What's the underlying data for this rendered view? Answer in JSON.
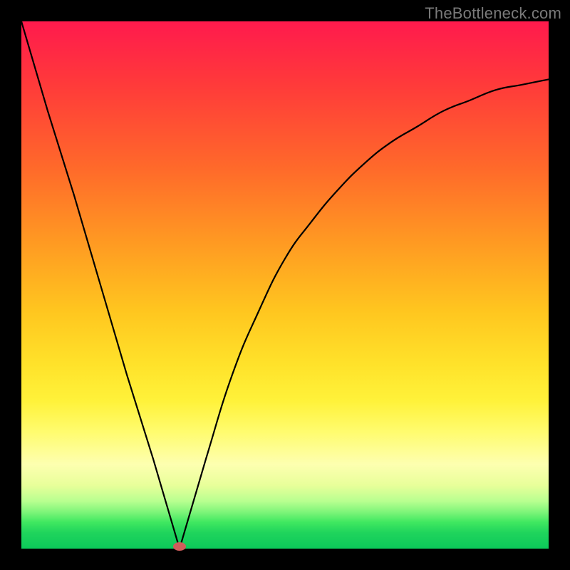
{
  "attribution": "TheBottleneck.com",
  "marker_color": "#cf5d5b",
  "curve_color": "#000000",
  "curve_stroke_width": 2.2,
  "chart_data": {
    "type": "line",
    "title": "",
    "xlabel": "",
    "ylabel": "",
    "xlim": [
      0,
      100
    ],
    "ylim": [
      0,
      100
    ],
    "y_axis_inverted_meaning": "lower y = better (green), higher y = worse (red)",
    "marker": {
      "x": 30,
      "y": 0
    },
    "series": [
      {
        "name": "bottleneck-curve",
        "x": [
          0,
          5,
          10,
          15,
          20,
          25,
          30,
          35,
          40,
          45,
          50,
          55,
          60,
          65,
          70,
          75,
          80,
          85,
          90,
          95,
          100
        ],
        "values": [
          100,
          83,
          67,
          50,
          33,
          17,
          0,
          17,
          33,
          45,
          55,
          62,
          68,
          73,
          77,
          80,
          83,
          85,
          87,
          88,
          89
        ]
      }
    ]
  }
}
